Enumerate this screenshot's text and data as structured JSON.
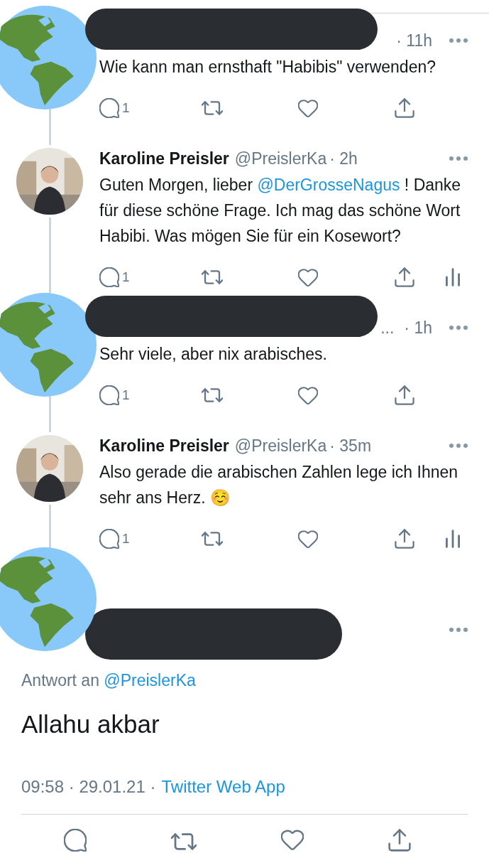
{
  "thread": [
    {
      "redacted": true,
      "time": "· 11h",
      "text_parts": [
        {
          "text": "Wie kann man ernsthaft \"Habibis\" verwenden?",
          "link": false
        }
      ],
      "replies": "1",
      "analytics": false
    },
    {
      "redacted": false,
      "name": "Karoline Preisler",
      "handle": "@PreislerKa",
      "time": "· 2h",
      "text_parts": [
        {
          "text": "Guten Morgen, lieber ",
          "link": false
        },
        {
          "text": "@DerGrosseNagus",
          "link": true
        },
        {
          "text": " ! Danke für diese schöne Frage. Ich mag das schöne Wort Habibi. Was mögen Sie für ein Kosewort?",
          "link": false
        }
      ],
      "replies": "1",
      "analytics": true
    },
    {
      "redacted": true,
      "time": "· 1h",
      "name_tail": "...",
      "text_parts": [
        {
          "text": "Sehr viele, aber nix arabisches.",
          "link": false
        }
      ],
      "replies": "1",
      "analytics": false
    },
    {
      "redacted": false,
      "name": "Karoline Preisler",
      "handle": "@PreislerKa",
      "time": "· 35m",
      "text_parts": [
        {
          "text": "Also gerade die arabischen Zahlen lege ich Ihnen sehr ans Herz. ☺️",
          "link": false
        }
      ],
      "replies": "1",
      "analytics": true
    }
  ],
  "main": {
    "redacted": true,
    "reply_label": "Antwort an",
    "reply_handle": "@PreislerKa",
    "text": "Allahu akbar",
    "time": "09:58 · 29.01.21 ·",
    "source": "Twitter Web App"
  }
}
